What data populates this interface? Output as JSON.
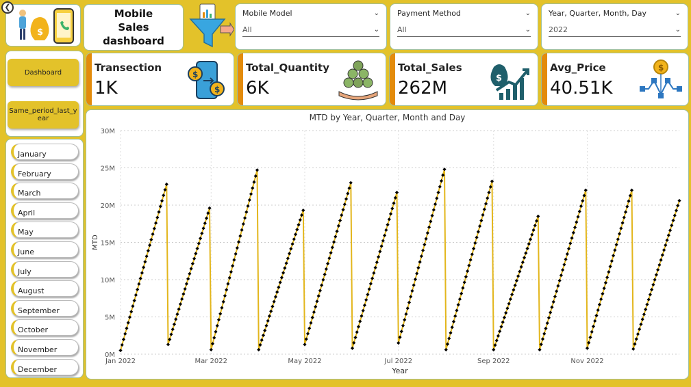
{
  "header": {
    "title": "Mobile Sales dashboard",
    "back_icon": "back-arrow-icon"
  },
  "filters": [
    {
      "label": "Mobile Model",
      "value": "All"
    },
    {
      "label": "Payment Method",
      "value": "All"
    },
    {
      "label": "Year, Quarter, Month, Day",
      "value": "2022"
    }
  ],
  "nav": {
    "dashboard_label": "Dashboard",
    "same_period_label": "Same_period_last_year"
  },
  "months": [
    "January",
    "February",
    "March",
    "April",
    "May",
    "June",
    "July",
    "August",
    "September",
    "October",
    "November",
    "December"
  ],
  "kpis": [
    {
      "label": "Transection",
      "value": "1K",
      "icon": "transaction-exchange-icon"
    },
    {
      "label": "Total_Quantity",
      "value": "6K",
      "icon": "money-bags-hand-icon"
    },
    {
      "label": "Total_Sales",
      "value": "262M",
      "icon": "money-growth-chart-icon"
    },
    {
      "label": "Avg_Price",
      "value": "40.51K",
      "icon": "coin-network-icon"
    }
  ],
  "colors": {
    "background": "#e3c22a",
    "accent": "#e38b0b",
    "line": "#e3b61c",
    "marker": "#000000"
  },
  "chart_data": {
    "type": "line",
    "title": "MTD by Year, Quarter, Month and Day",
    "xlabel": "Year",
    "ylabel": "MTD",
    "xticks": [
      "Jan 2022",
      "Mar 2022",
      "May 2022",
      "Jul 2022",
      "Sep 2022",
      "Nov 2022"
    ],
    "yticks": [
      "0M",
      "5M",
      "10M",
      "15M",
      "20M",
      "25M",
      "30M"
    ],
    "ylim": [
      0,
      30000000
    ],
    "xlim": [
      "2022-01-01",
      "2022-12-31"
    ],
    "grid": true,
    "series": [
      {
        "months": [
          "2022-01",
          "2022-02",
          "2022-03",
          "2022-04",
          "2022-05",
          "2022-06",
          "2022-07",
          "2022-08",
          "2022-09",
          "2022-10",
          "2022-11",
          "2022-12"
        ],
        "days_in_month": [
          31,
          28,
          31,
          30,
          31,
          30,
          31,
          31,
          30,
          31,
          30,
          31
        ],
        "start_values": [
          500000,
          1300000,
          600000,
          600000,
          1300000,
          800000,
          1500000,
          600000,
          600000,
          600000,
          800000,
          700000
        ],
        "end_values": [
          22800000,
          19600000,
          24700000,
          19300000,
          23000000,
          21700000,
          24800000,
          23200000,
          18500000,
          22000000,
          22000000,
          20600000
        ]
      }
    ]
  }
}
